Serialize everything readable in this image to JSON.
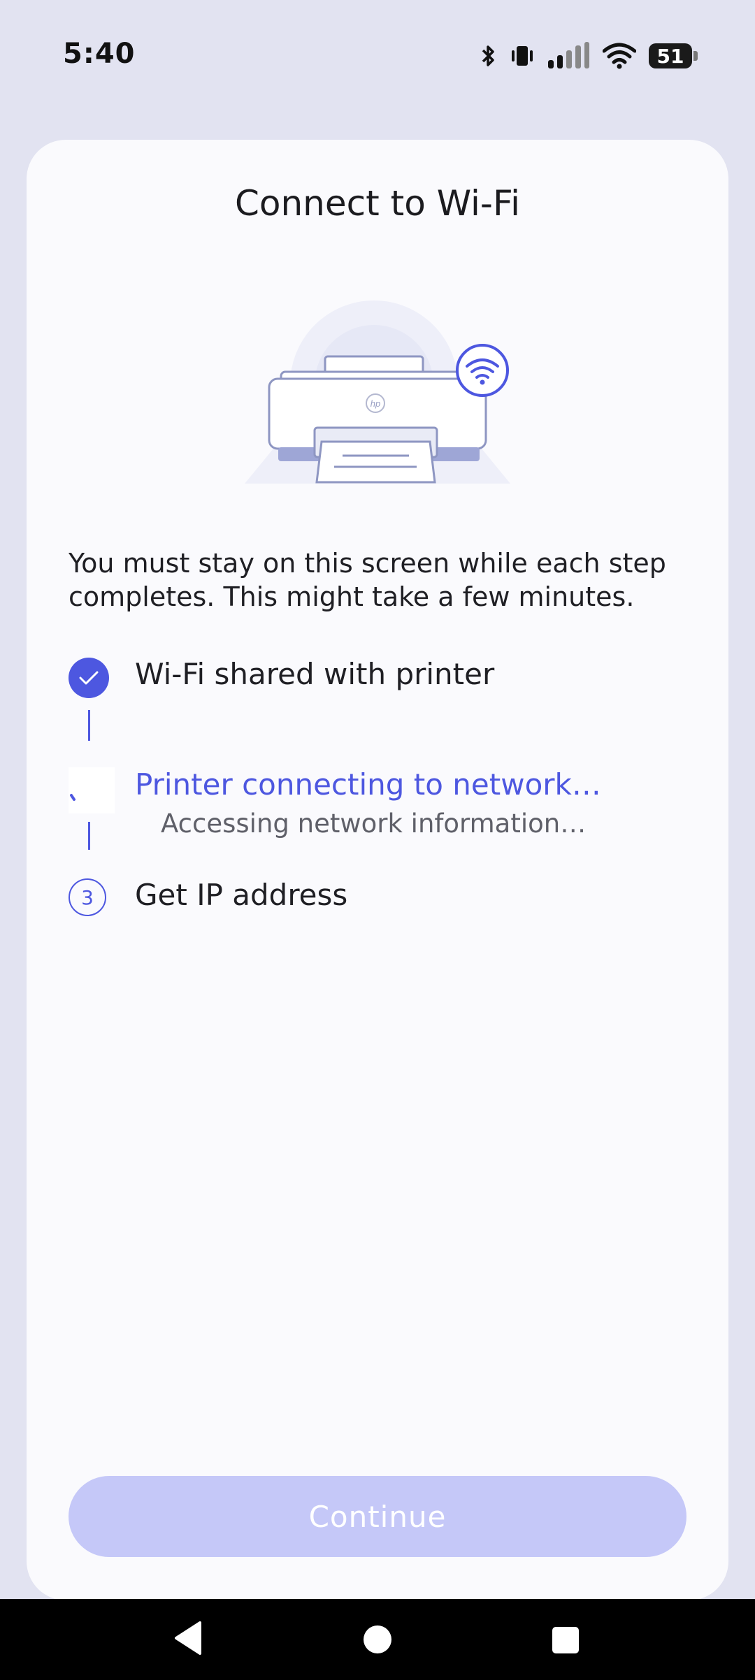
{
  "status_bar": {
    "time": "5:40",
    "battery_level": "51",
    "icons": [
      "bluetooth-icon",
      "vibrate-icon",
      "signal-icon",
      "wifi-icon",
      "battery-icon"
    ]
  },
  "page": {
    "title": "Connect to Wi-Fi",
    "illustration": "printer-wifi-illustration",
    "intro": "You must stay on this screen while each step completes. This might take a few minutes."
  },
  "steps": [
    {
      "label": "Wi-Fi shared with printer",
      "status": "complete"
    },
    {
      "label": "Printer connecting to network…",
      "sublabel": "Accessing network information…",
      "status": "in-progress"
    },
    {
      "number": "3",
      "label": "Get IP address",
      "status": "pending"
    }
  ],
  "actions": {
    "continue_label": "Continue"
  },
  "colors": {
    "accent": "#4d57e0",
    "button_disabled": "#c5c8f8",
    "background": "#e2e3f1",
    "card": "#fafafd"
  }
}
